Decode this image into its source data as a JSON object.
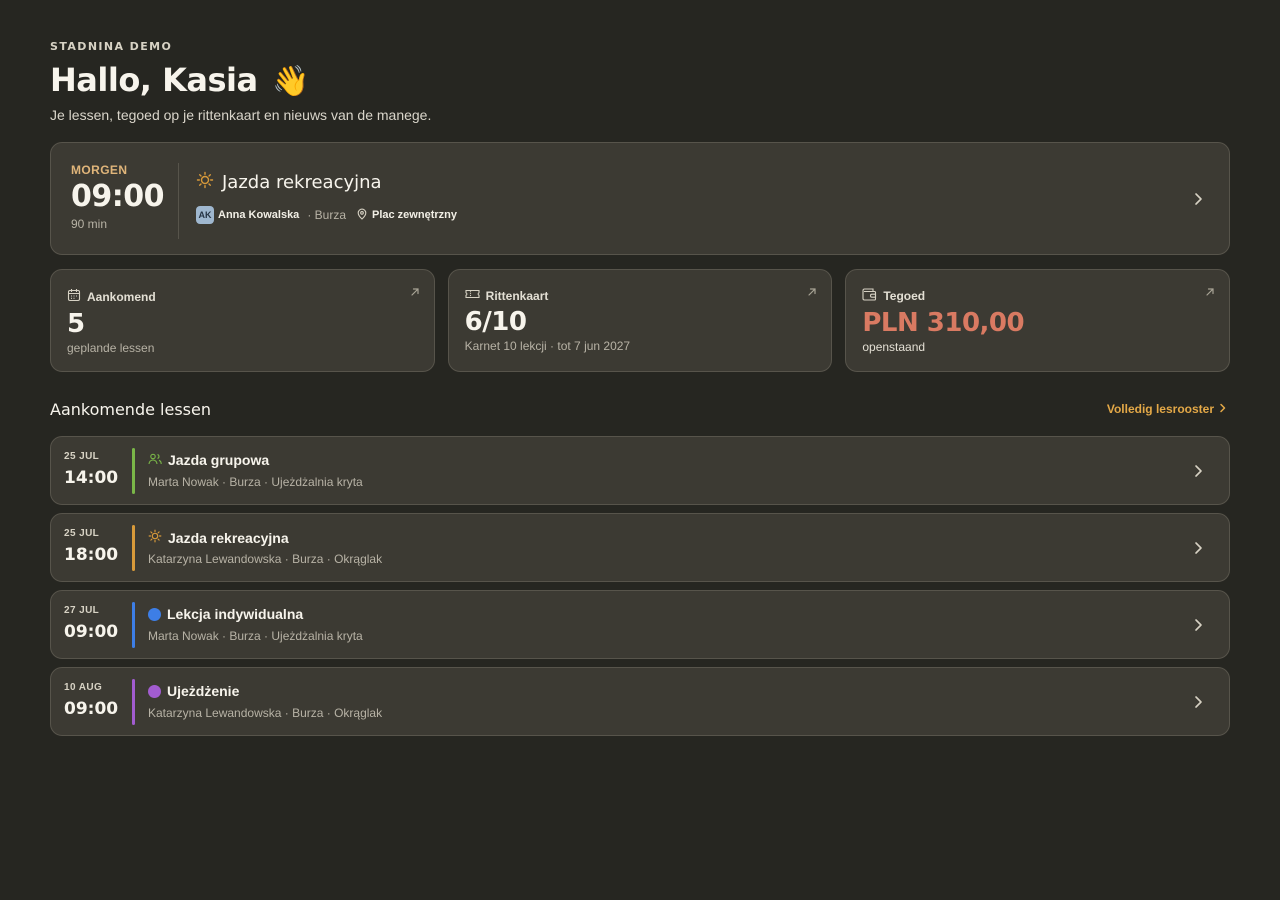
{
  "header": {
    "eyebrow": "STADNINA DEMO",
    "greeting": "Hallo, Kasia",
    "wave": "👋",
    "subtitle": "Je lessen, tegoed op je rittenkaart en nieuws van de manege."
  },
  "next_lesson": {
    "when": "MORGEN",
    "time": "09:00",
    "duration": "90 min",
    "title": "Jazda rekreacyjna",
    "icon": "sun-icon",
    "instructor_initials": "AK",
    "instructor": "Anna Kowalska",
    "horse": "· Burza",
    "location": "Plac zewnętrzny"
  },
  "stats": [
    {
      "icon": "calendar-icon",
      "label": "Aankomend",
      "value": "5",
      "desc": "geplande lessen"
    },
    {
      "icon": "ticket-icon",
      "label": "Rittenkaart",
      "value": "6/10",
      "desc": "Karnet 10 lekcji · tot 7 jun 2027"
    },
    {
      "icon": "wallet-icon",
      "label": "Tegoed",
      "value": "PLN 310,00",
      "desc": "openstaand"
    }
  ],
  "upcoming": {
    "title": "Aankomende lessen",
    "link": "Volledig lesrooster",
    "items": [
      {
        "date": "25 JUL",
        "time": "14:00",
        "color": "#7ab648",
        "icon": "group-icon",
        "title": "Jazda grupowa",
        "meta": "Marta Nowak · Burza · Ujeżdżalnia kryta"
      },
      {
        "date": "25 JUL",
        "time": "18:00",
        "color": "#d89a3a",
        "icon": "sun-icon",
        "title": "Jazda rekreacyjna",
        "meta": "Katarzyna Lewandowska · Burza · Okrąglak"
      },
      {
        "date": "27 JUL",
        "time": "09:00",
        "color": "#3d7ee6",
        "icon": "blue-dot-icon",
        "title": "Lekcja indywidualna",
        "meta": "Marta Nowak · Burza · Ujeżdżalnia kryta"
      },
      {
        "date": "10 AUG",
        "time": "09:00",
        "color": "#a25cd0",
        "icon": "purple-dot-icon",
        "title": "Ujeżdżenie",
        "meta": "Katarzyna Lewandowska · Burza · Okrąglak"
      }
    ]
  },
  "colors": {
    "accent": "#e3a847",
    "balance": "#d97a62",
    "morgen": "#e0b57a"
  }
}
